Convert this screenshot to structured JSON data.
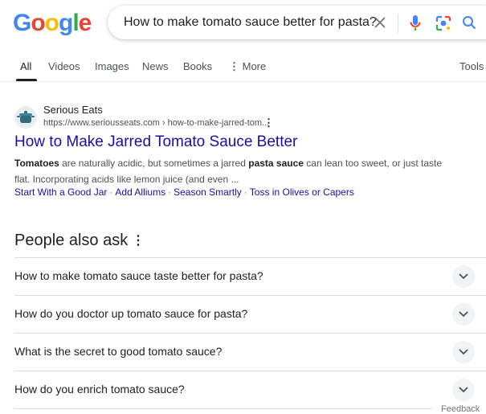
{
  "logo": {
    "letters": [
      "G",
      "o",
      "o",
      "g",
      "l",
      "e"
    ],
    "colors": [
      "#4285f4",
      "#ea4335",
      "#fbbc05",
      "#4285f4",
      "#34a853",
      "#ea4335"
    ]
  },
  "search": {
    "query": "How to make tomato sauce better for pasta?"
  },
  "tabs": [
    {
      "label": "All",
      "active": true
    },
    {
      "label": "Videos"
    },
    {
      "label": "Images"
    },
    {
      "label": "News"
    },
    {
      "label": "Books"
    },
    {
      "label": "More",
      "icon": "vertical-dots-icon"
    }
  ],
  "tools_label": "Tools",
  "result": {
    "favicon": "pot-icon",
    "site_name": "Serious Eats",
    "url": "https://www.seriousseats.com › how-to-make-jarred-tom...",
    "title": "How to Make Jarred Tomato Sauce Better",
    "snippet": [
      {
        "text": "Tomatoes",
        "bold": true
      },
      {
        "text": " are naturally acidic, but sometimes a jarred ",
        "bold": false
      },
      {
        "text": "pasta sauce",
        "bold": true
      },
      {
        "text": " can lean too sweet, or just taste flat. Incorporating acids like lemon juice (and even ...",
        "bold": false
      }
    ],
    "sitelinks": [
      "Start With a Good Jar",
      "Add Alliums",
      "Season Smartly",
      "Toss in Olives or Capers"
    ]
  },
  "people_also_ask": {
    "heading": "People also ask",
    "questions": [
      "How to make tomato sauce taste better for pasta?",
      "How do you doctor up tomato sauce for pasta?",
      "What is the secret to good tomato sauce?",
      "How do you enrich tomato sauce?"
    ]
  },
  "feedback_label": "Feedback",
  "colors": {
    "link": "#1a0dab",
    "text": "#202124",
    "muted": "#4d5156"
  }
}
